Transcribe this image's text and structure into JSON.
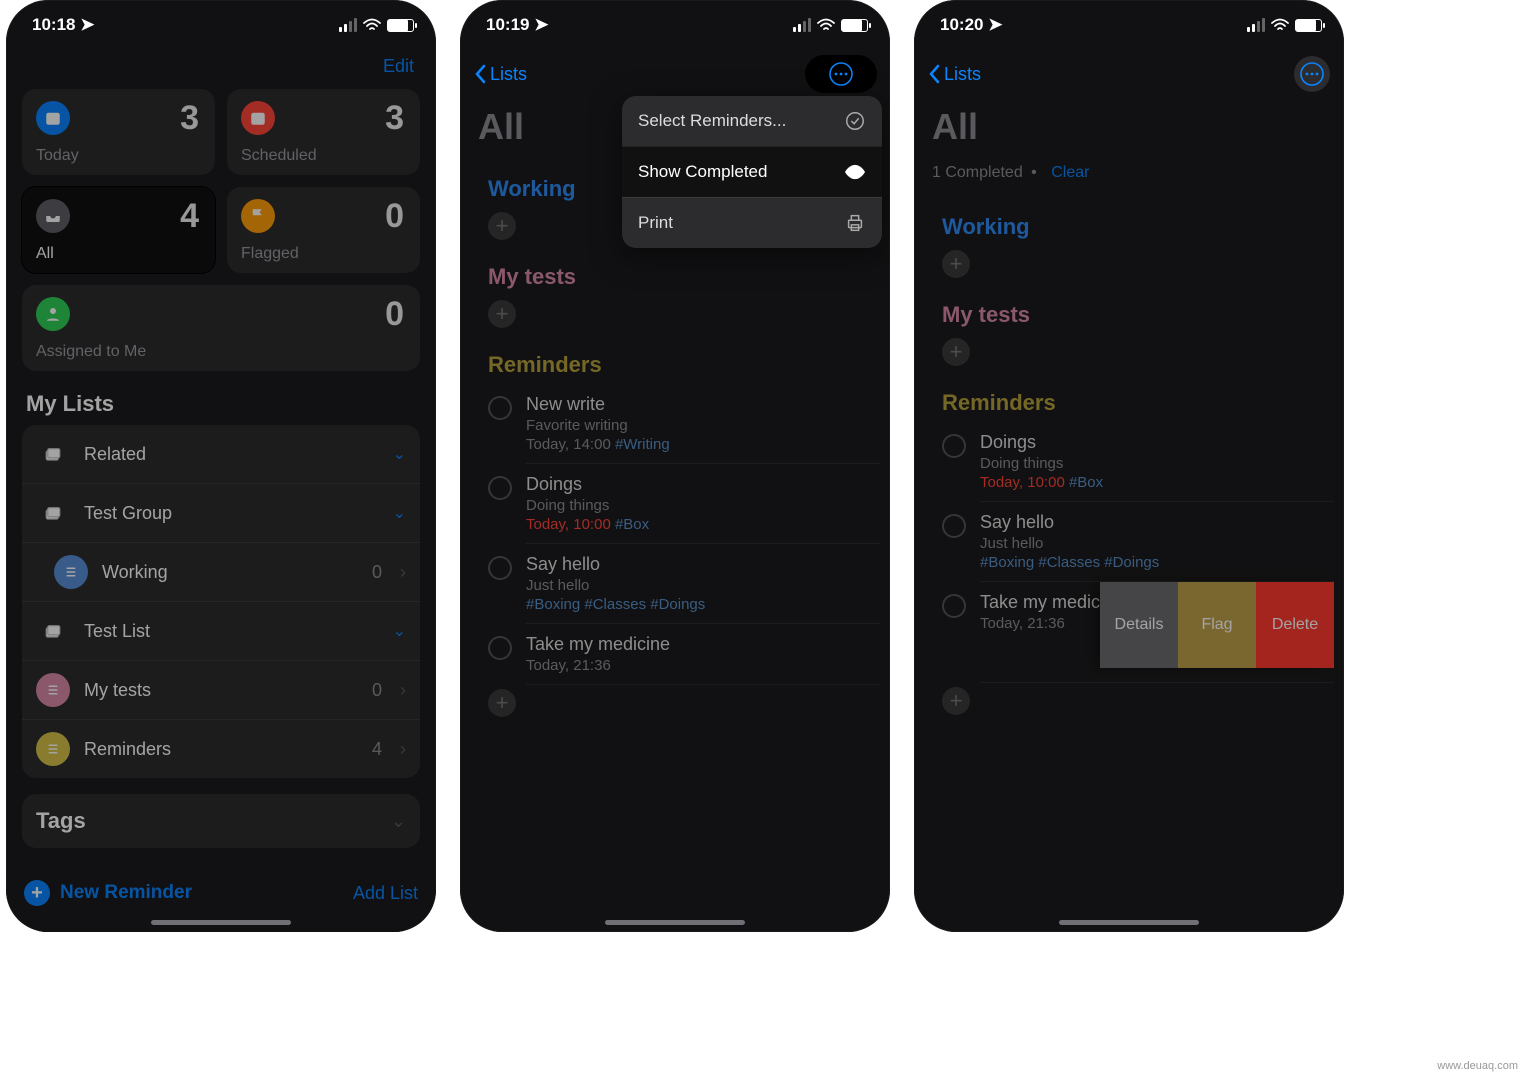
{
  "watermark": "www.deuaq.com",
  "screen1": {
    "time": "10:18",
    "edit": "Edit",
    "cards": {
      "today": {
        "label": "Today",
        "count": "3"
      },
      "scheduled": {
        "label": "Scheduled",
        "count": "3"
      },
      "all": {
        "label": "All",
        "count": "4"
      },
      "flagged": {
        "label": "Flagged",
        "count": "0"
      },
      "assigned": {
        "label": "Assigned to Me",
        "count": "0"
      }
    },
    "mylists_title": "My Lists",
    "lists": {
      "related": {
        "label": "Related"
      },
      "testgroup": {
        "label": "Test Group"
      },
      "working": {
        "label": "Working",
        "count": "0"
      },
      "testlist": {
        "label": "Test List"
      },
      "mytests": {
        "label": "My tests",
        "count": "0"
      },
      "reminders": {
        "label": "Reminders",
        "count": "4"
      }
    },
    "tags_title": "Tags",
    "new_reminder": "New Reminder",
    "add_list": "Add List"
  },
  "screen2": {
    "time": "10:19",
    "back": "Lists",
    "title": "All",
    "popup": {
      "select": "Select Reminders...",
      "show": "Show Completed",
      "print": "Print"
    },
    "groups": {
      "working": "Working",
      "mytests": "My tests",
      "reminders": "Reminders"
    },
    "items": {
      "newwrite": {
        "title": "New write",
        "sub": "Favorite writing",
        "time": "Today, 14:00 ",
        "tag": "#Writing"
      },
      "doings": {
        "title": "Doings",
        "sub": "Doing things",
        "time": "Today, 10:00 ",
        "tag": "#Box"
      },
      "sayhello": {
        "title": "Say hello",
        "sub": "Just hello",
        "tags": "#Boxing #Classes #Doings"
      },
      "medicine": {
        "title": "Take my medicine",
        "time": "Today, 21:36"
      }
    }
  },
  "screen3": {
    "time": "10:20",
    "back": "Lists",
    "title": "All",
    "completed": "1 Completed",
    "dot": "•",
    "clear": "Clear",
    "groups": {
      "working": "Working",
      "mytests": "My tests",
      "reminders": "Reminders"
    },
    "items": {
      "doings": {
        "title": "Doings",
        "sub": "Doing things",
        "time": "Today, 10:00 ",
        "tag": "#Box"
      },
      "sayhello": {
        "title": "Say hello",
        "sub": "Just hello",
        "tags": "#Boxing #Classes #Doings"
      },
      "medicine": {
        "title": "Take my medicine",
        "time": "Today, 21:36"
      }
    },
    "swipe": {
      "details": "Details",
      "flag": "Flag",
      "delete": "Delete"
    }
  }
}
